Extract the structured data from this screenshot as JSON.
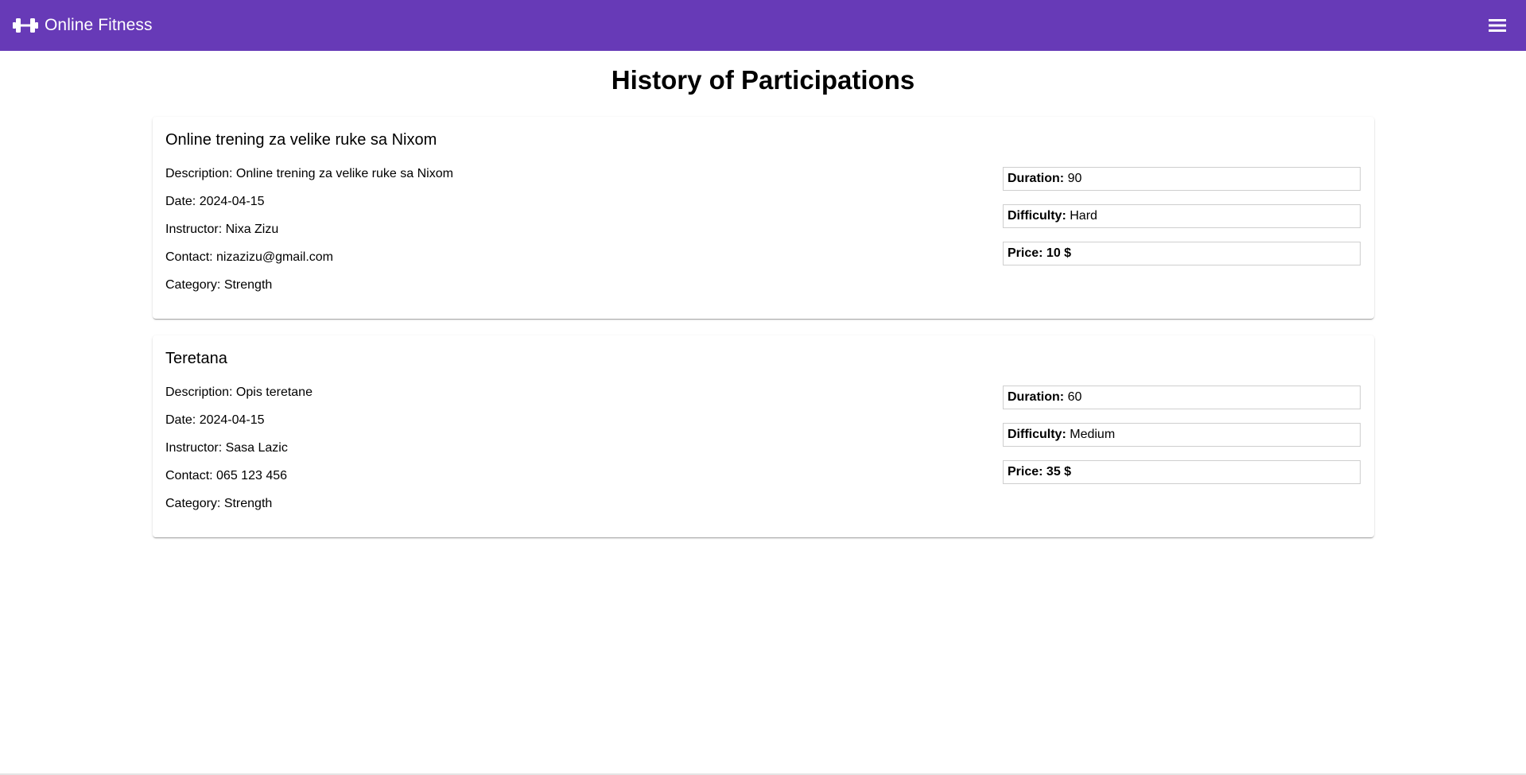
{
  "app": {
    "title": "Online Fitness",
    "logo_icon": "dumbbell-icon",
    "menu_icon": "hamburger-menu-icon",
    "colors": {
      "toolbar": "#673ab7",
      "toolbar_text": "#ffffff"
    }
  },
  "page": {
    "title": "History of Participations"
  },
  "participations": [
    {
      "name": "Online trening za velike ruke sa Nixom",
      "description": "Description: Online trening za velike ruke sa Nixom",
      "date": "Date: 2024-04-15",
      "instructor": "Instructor: Nixa Zizu",
      "contact": "Contact: nizazizu@gmail.com",
      "category": "Category: Strength",
      "duration_label": "Duration:",
      "duration_value": "90",
      "difficulty_label": "Difficulty:",
      "difficulty_value": "Hard",
      "price": "Price: 10 $"
    },
    {
      "name": "Teretana",
      "description": "Description: Opis teretane",
      "date": "Date: 2024-04-15",
      "instructor": "Instructor: Sasa Lazic",
      "contact": "Contact: 065 123 456",
      "category": "Category: Strength",
      "duration_label": "Duration:",
      "duration_value": "60",
      "difficulty_label": "Difficulty:",
      "difficulty_value": "Medium",
      "price": "Price: 35 $"
    }
  ]
}
